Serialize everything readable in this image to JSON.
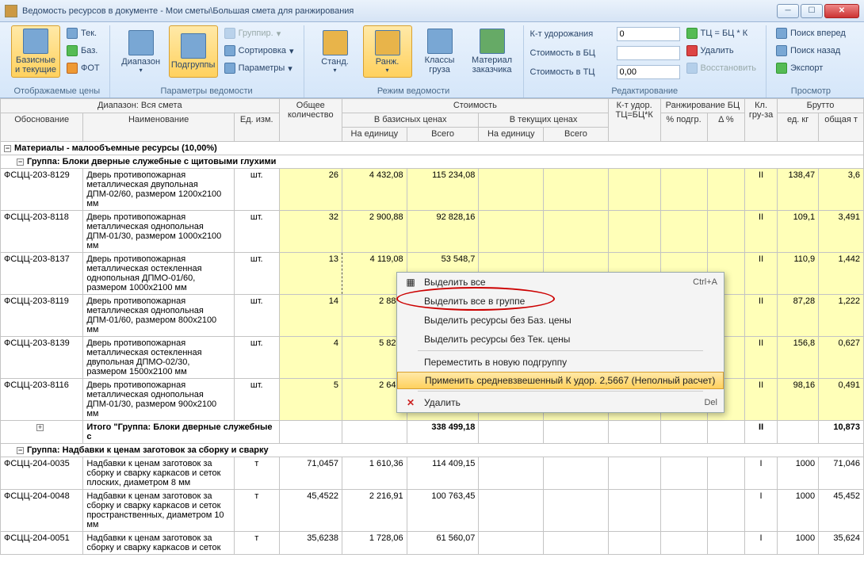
{
  "window": {
    "title": "Ведомость ресурсов в документе - Мои сметы\\Большая смета для ранжирования"
  },
  "ribbon": {
    "group1": {
      "big": "Базисные и текущие",
      "tek": "Тек.",
      "baz": "Баз.",
      "fot": "ФОТ",
      "label": "Отображаемые цены"
    },
    "group2": {
      "range": "Диапазон",
      "sub": "Подгруппы",
      "grup": "Группир.",
      "sort": "Сортировка",
      "params": "Параметры",
      "label": "Параметры ведомости"
    },
    "group3": {
      "std": "Станд.",
      "rank": "Ранж.",
      "class": "Классы груза",
      "mat": "Материал заказчика",
      "label": "Режим ведомости"
    },
    "group4": {
      "kudor": "К-т удорожания",
      "kudor_v": "0",
      "sbc": "Стоимость в БЦ",
      "sbc_v": "",
      "stc": "Стоимость в ТЦ",
      "stc_v": "0,00",
      "tc": "ТЦ = БЦ * К",
      "del": "Удалить",
      "rest": "Восстановить",
      "label": "Редактирование"
    },
    "group5": {
      "fwd": "Поиск вперед",
      "back": "Поиск назад",
      "exp": "Экспорт",
      "label": "Просмотр"
    }
  },
  "headers": {
    "range": "Диапазон: Вся смета",
    "qty": "Общее количество",
    "cost": "Стоимость",
    "kudor": "К-т удор. ТЦ=БЦ*К",
    "rank": "Ранжирование БЦ",
    "cls": "Кл. гру-за",
    "brutto": "Брутто",
    "base": "В базисных ценах",
    "cur": "В текущих ценах",
    "basis": "Обоснование",
    "name": "Наименование",
    "unit": "Ед. изм.",
    "per": "На единицу",
    "total": "Всего",
    "pct": "% подгр.",
    "dpct": "Δ %",
    "kg": "ед. кг",
    "t": "общая т"
  },
  "cat1": "Материалы - малообъемные ресурсы (10,00%)",
  "grp1": "Группа: Блоки дверные служебные с щитовыми глухими",
  "rows": [
    {
      "code": "ФСЦЦ-203-8129",
      "name": "Дверь противопожарная металлическая двупольная ДПМ-02/60, размером 1200x2100 мм",
      "u": "шт.",
      "q": "26",
      "p": "4 432,08",
      "t": "115 234,08",
      "cls": "II",
      "kg": "138,47",
      "tt": "3,6"
    },
    {
      "code": "ФСЦЦ-203-8118",
      "name": "Дверь противопожарная металлическая однопольная ДПМ-01/30, размером 1000x2100 мм",
      "u": "шт.",
      "q": "32",
      "p": "2 900,88",
      "t": "92 828,16",
      "cls": "II",
      "kg": "109,1",
      "tt": "3,491"
    },
    {
      "code": "ФСЦЦ-203-8137",
      "name": "Дверь противопожарная металлическая остекленная однопольная ДПМО-01/60, размером 1000x2100 мм",
      "u": "шт.",
      "q": "13",
      "p": "4 119,08",
      "t": "53 548,7",
      "cls": "II",
      "kg": "110,9",
      "tt": "1,442"
    },
    {
      "code": "ФСЦЦ-203-8119",
      "name": "Дверь противопожарная металлическая однопольная ДПМ-01/60, размером 800x2100 мм",
      "u": "шт.",
      "q": "14",
      "p": "2 884,",
      "t": "",
      "cls": "II",
      "kg": "87,28",
      "tt": "1,222"
    },
    {
      "code": "ФСЦЦ-203-8139",
      "name": "Дверь противопожарная металлическая остекленная двупольная ДПМО-02/30, размером 1500x2100 мм",
      "u": "шт.",
      "q": "4",
      "p": "5 825,",
      "t": "",
      "cls": "II",
      "kg": "156,8",
      "tt": "0,627"
    },
    {
      "code": "ФСЦЦ-203-8116",
      "name": "Дверь противопожарная металлическая однопольная ДПМ-01/30, размером 900x2100 мм",
      "u": "шт.",
      "q": "5",
      "p": "2 640,",
      "t": "",
      "cls": "II",
      "kg": "98,16",
      "tt": "0,491"
    }
  ],
  "subtotal": {
    "label": "Итого \"Группа: Блоки дверные служебные с",
    "total": "338 499,18",
    "cls": "II",
    "tt": "10,873"
  },
  "grp2": "Группа: Надбавки к ценам заготовок за сборку и сварку",
  "rows2": [
    {
      "code": "ФСЦЦ-204-0035",
      "name": "Надбавки к ценам заготовок за сборку и сварку каркасов и сеток плоских, диаметром 8 мм",
      "u": "т",
      "q": "71,0457",
      "p": "1 610,36",
      "t": "114 409,15",
      "cls": "I",
      "kg": "1000",
      "tt": "71,046"
    },
    {
      "code": "ФСЦЦ-204-0048",
      "name": "Надбавки к ценам заготовок за сборку и сварку каркасов и сеток пространственных, диаметром 10 мм",
      "u": "т",
      "q": "45,4522",
      "p": "2 216,91",
      "t": "100 763,45",
      "cls": "I",
      "kg": "1000",
      "tt": "45,452"
    },
    {
      "code": "ФСЦЦ-204-0051",
      "name": "Надбавки к ценам заготовок за сборку и сварку каркасов и сеток",
      "u": "т",
      "q": "35,6238",
      "p": "1 728,06",
      "t": "61 560,07",
      "cls": "I",
      "kg": "1000",
      "tt": "35,624"
    }
  ],
  "ctx": {
    "selall": "Выделить все",
    "selall_sc": "Ctrl+A",
    "selgrp": "Выделить все в группе",
    "selnob": "Выделить ресурсы без Баз. цены",
    "selnot": "Выделить ресурсы без Тек. цены",
    "move": "Переместить в новую подгруппу",
    "apply": "Применить средневзвешенный К удор. 2,5667 (Неполный расчет)",
    "del": "Удалить",
    "del_sc": "Del"
  }
}
